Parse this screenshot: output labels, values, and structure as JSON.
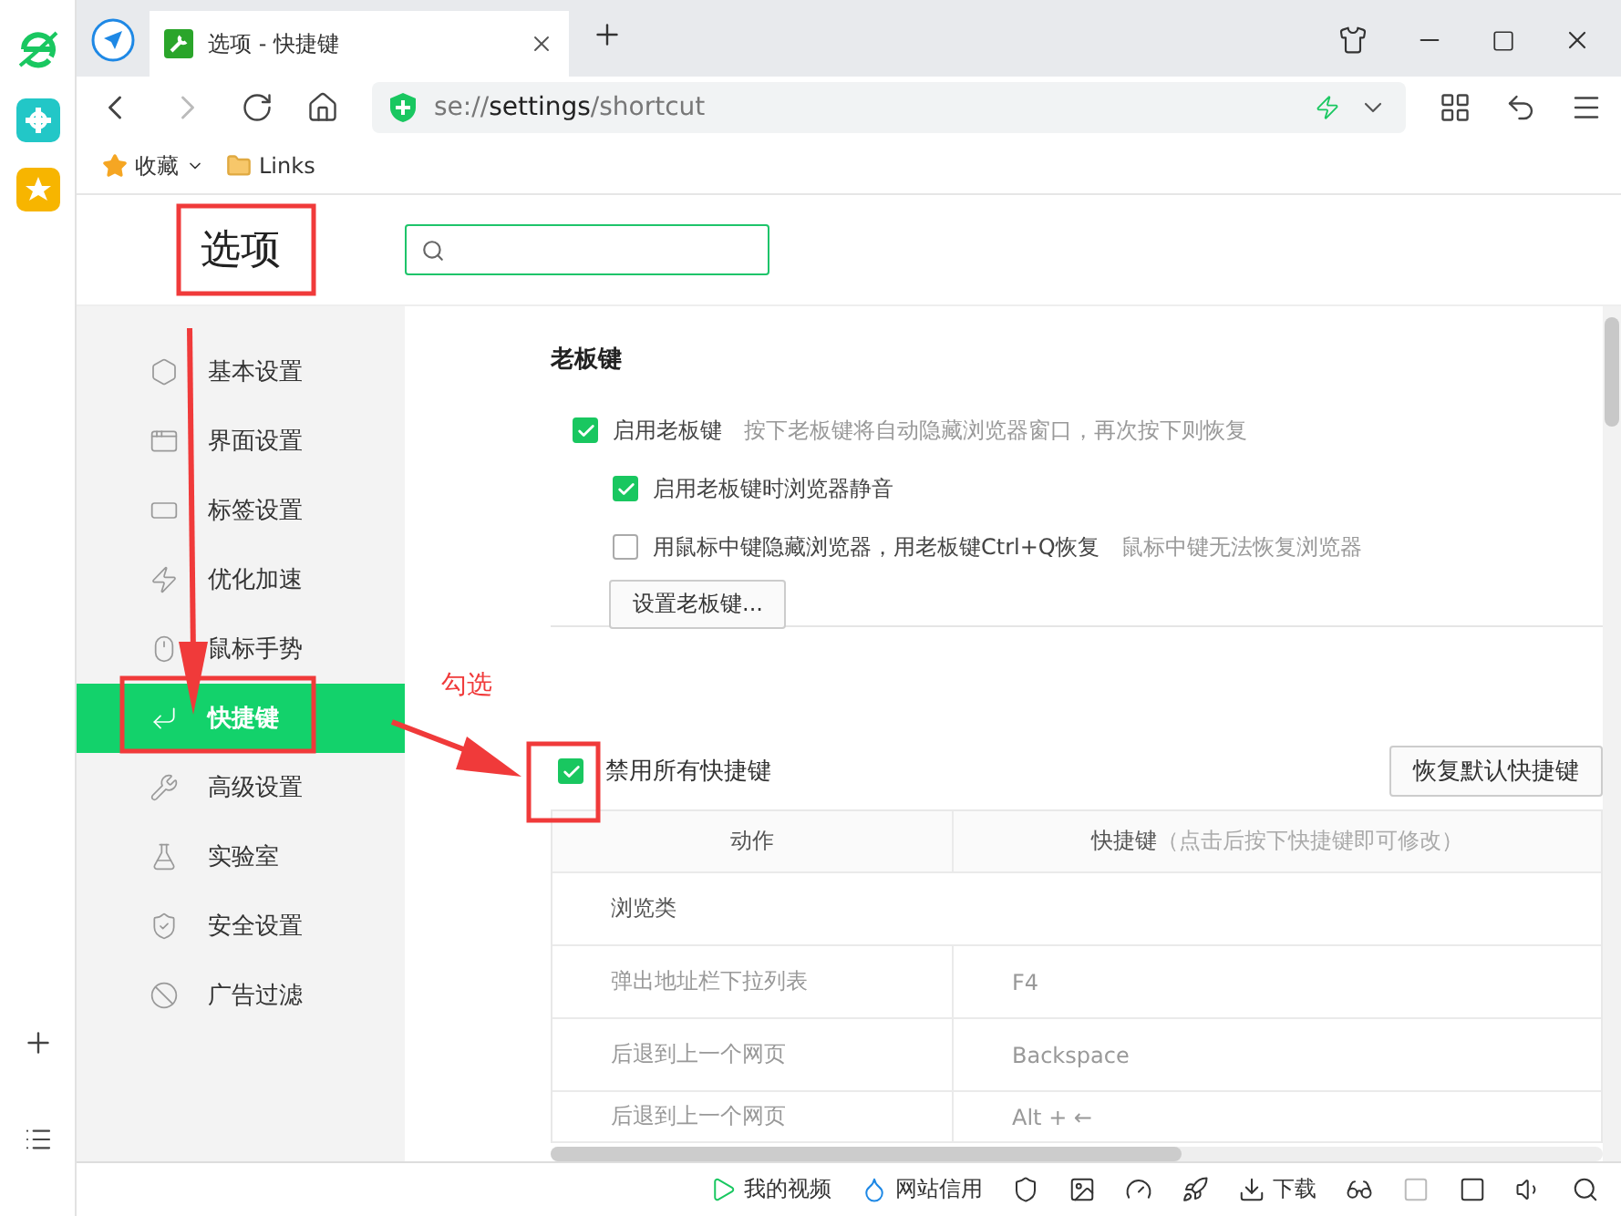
{
  "tab": {
    "title": "选项 - 快捷键"
  },
  "address": {
    "scheme": "se://",
    "host": "settings",
    "path": "/shortcut"
  },
  "bookmarks": [
    {
      "label": "收藏",
      "kind": "star"
    },
    {
      "label": "Links",
      "kind": "folder"
    }
  ],
  "page_title": "选项",
  "nav": [
    {
      "label": "基本设置",
      "kind": "hexagon",
      "selected": false
    },
    {
      "label": "界面设置",
      "kind": "window",
      "selected": false
    },
    {
      "label": "标签设置",
      "kind": "tab",
      "selected": false
    },
    {
      "label": "优化加速",
      "kind": "bolt",
      "selected": false
    },
    {
      "label": "鼠标手势",
      "kind": "mouse",
      "selected": false
    },
    {
      "label": "快捷键",
      "kind": "enter",
      "selected": true
    },
    {
      "label": "高级设置",
      "kind": "wrench",
      "selected": false
    },
    {
      "label": "实验室",
      "kind": "flask",
      "selected": false
    },
    {
      "label": "安全设置",
      "kind": "shield",
      "selected": false
    },
    {
      "label": "广告过滤",
      "kind": "block",
      "selected": false
    }
  ],
  "boss_key": {
    "heading": "老板键",
    "options": [
      {
        "label": "启用老板键",
        "hint": "按下老板键将自动隐藏浏览器窗口，再次按下则恢复",
        "checked": true,
        "children": [
          {
            "label": "启用老板键时浏览器静音",
            "checked": true
          },
          {
            "label": "用鼠标中键隐藏浏览器，用老板键Ctrl+Q恢复",
            "hint": "鼠标中键无法恢复浏览器",
            "checked": false
          }
        ]
      }
    ],
    "button": "设置老板键..."
  },
  "annotation": "勾选",
  "disable_all": {
    "label": "禁用所有快捷键",
    "checked": true
  },
  "restore_button": "恢复默认快捷键",
  "table": {
    "columns": [
      {
        "label": "动作"
      },
      {
        "label": "快捷键",
        "hint": "（点击后按下快捷键即可修改）"
      }
    ],
    "rows": [
      {
        "kind": "group",
        "action": "浏览类"
      },
      {
        "kind": "shortcut",
        "action": "弹出地址栏下拉列表",
        "key": "F4"
      },
      {
        "kind": "shortcut",
        "action": "后退到上一个网页",
        "key": "Backspace"
      },
      {
        "kind": "shortcut",
        "action": "后退到上一个网页",
        "key": "Alt + ←"
      }
    ]
  },
  "status_bar": [
    {
      "kind": "video",
      "label": "我的视频"
    },
    {
      "kind": "drop",
      "label": "网站信用"
    },
    {
      "kind": "shield"
    },
    {
      "kind": "image"
    },
    {
      "kind": "speed"
    },
    {
      "kind": "rocket"
    },
    {
      "kind": "download",
      "label": "下载"
    },
    {
      "kind": "glasses"
    },
    {
      "kind": "ie"
    },
    {
      "kind": "window"
    },
    {
      "kind": "sound"
    },
    {
      "kind": "search"
    }
  ]
}
